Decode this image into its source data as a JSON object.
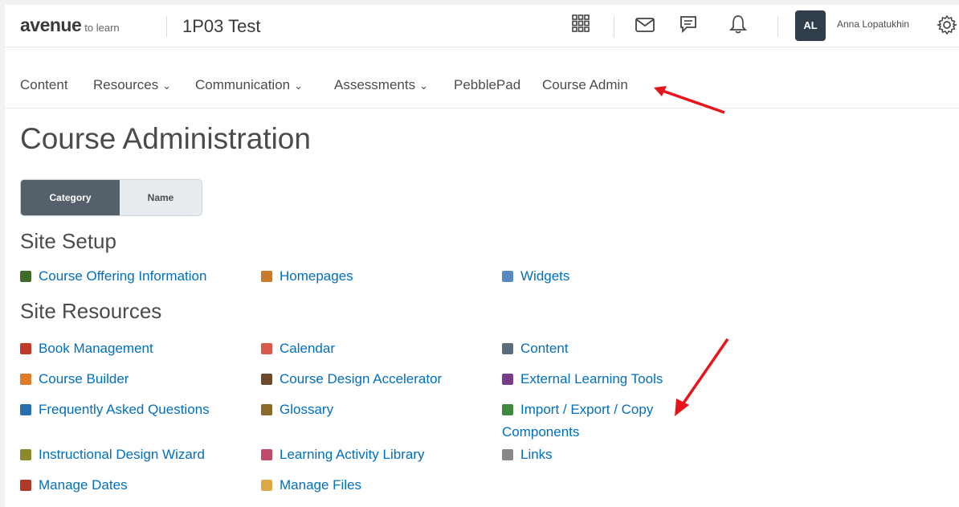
{
  "topbar": {
    "logo_brand": "avenue",
    "logo_sub": "to learn",
    "course_title": "1P03 Test",
    "icons": [
      "waffle-icon",
      "mail-icon",
      "chat-icon",
      "bell-icon"
    ],
    "avatar_initials": "AL",
    "user_name": "Anna Lopatukhin"
  },
  "nav": {
    "items": [
      {
        "label": "Content",
        "dropdown": false
      },
      {
        "label": "Resources",
        "dropdown": true
      },
      {
        "label": "Communication",
        "dropdown": true
      },
      {
        "label": "Assessments",
        "dropdown": true
      },
      {
        "label": "PebblePad",
        "dropdown": false
      },
      {
        "label": "Course Admin",
        "dropdown": false
      }
    ]
  },
  "page_title": "Course Administration",
  "view_toggle": {
    "selected": "Category",
    "options": [
      "Category",
      "Name"
    ]
  },
  "sections": [
    {
      "title": "Site Setup",
      "tools": [
        {
          "label": "Course Offering Information",
          "icon": "book-icon",
          "color": "#3e6b2a"
        },
        {
          "label": "Homepages",
          "icon": "house-icon",
          "color": "#c87b2a"
        },
        {
          "label": "Widgets",
          "icon": "widgets-icon",
          "color": "#5a8ac2"
        }
      ]
    },
    {
      "title": "Site Resources",
      "tools": [
        {
          "label": "Book Management",
          "icon": "books-icon",
          "color": "#c0392b"
        },
        {
          "label": "Calendar",
          "icon": "calendar-icon",
          "color": "#d65a4a"
        },
        {
          "label": "Content",
          "icon": "open-book-icon",
          "color": "#5a6b7a"
        },
        {
          "label": "Course Builder",
          "icon": "builder-icon",
          "color": "#e07b2a"
        },
        {
          "label": "Course Design Accelerator",
          "icon": "accelerator-icon",
          "color": "#6b4a2a"
        },
        {
          "label": "External Learning Tools",
          "icon": "external-tool-icon",
          "color": "#7a3a8a"
        },
        {
          "label": "Frequently Asked Questions",
          "icon": "faq-icon",
          "color": "#2a6fb0"
        },
        {
          "label": "Glossary",
          "icon": "glossary-icon",
          "color": "#8a6a2a"
        },
        {
          "label": "Import / Export / Copy Components",
          "icon": "import-export-icon",
          "color": "#3e8a3e"
        },
        {
          "label": "Instructional Design Wizard",
          "icon": "wand-icon",
          "color": "#8a8a2a"
        },
        {
          "label": "Learning Activity Library",
          "icon": "library-icon",
          "color": "#c04a6a"
        },
        {
          "label": "Links",
          "icon": "link-icon",
          "color": "#888888"
        },
        {
          "label": "Manage Dates",
          "icon": "dates-icon",
          "color": "#b03a2a"
        },
        {
          "label": "Manage Files",
          "icon": "folder-icon",
          "color": "#d9a94a"
        }
      ]
    }
  ]
}
